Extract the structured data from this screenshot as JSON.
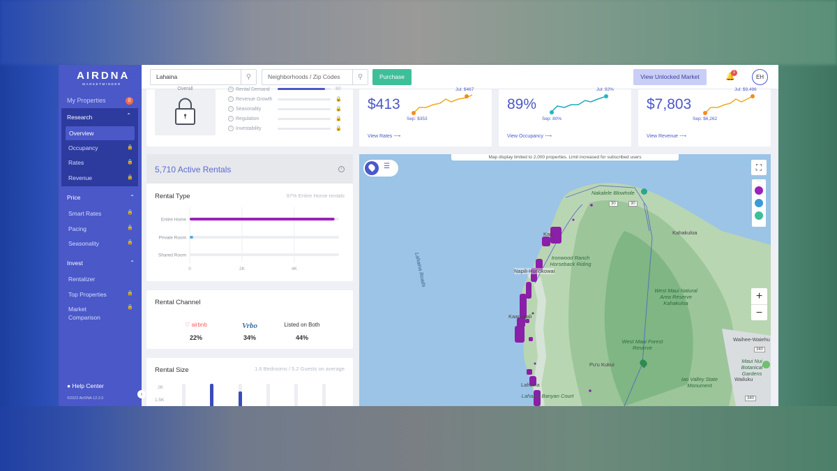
{
  "app": {
    "logo": "AIRDNA",
    "logo_sub": "MARKETMINDER",
    "copyright": "©2022 AirDNA 12.2.0"
  },
  "sidebar": {
    "my_properties": "My Properties",
    "my_properties_count": "0",
    "research": {
      "label": "Research",
      "items": [
        {
          "label": "Overview",
          "active": true
        },
        {
          "label": "Occupancy",
          "locked": true
        },
        {
          "label": "Rates",
          "locked": true
        },
        {
          "label": "Revenue",
          "locked": true
        }
      ]
    },
    "price": {
      "label": "Price",
      "items": [
        {
          "label": "Smart Rates",
          "locked": true
        },
        {
          "label": "Pacing",
          "locked": true
        },
        {
          "label": "Seasonality",
          "locked": true
        }
      ]
    },
    "invest": {
      "label": "Invest",
      "items": [
        {
          "label": "Rentalizer"
        },
        {
          "label": "Top Properties",
          "locked": true
        },
        {
          "label": "Market Comparison",
          "locked": true
        }
      ]
    },
    "help": "Help Center"
  },
  "topbar": {
    "market_value": "Lahaina",
    "neighborhood_placeholder": "Neighborhoods / Zip Codes",
    "purchase": "Purchase",
    "view_unlocked": "View Unlocked Market",
    "notifications": "1",
    "avatar": "EH"
  },
  "score": {
    "overall_label": "Overall",
    "factors": [
      {
        "label": "Rental Demand",
        "value": "80"
      },
      {
        "label": "Revenue Growth"
      },
      {
        "label": "Seasonality"
      },
      {
        "label": "Regulation"
      },
      {
        "label": "Investability"
      }
    ]
  },
  "kpis": [
    {
      "value": "$413",
      "low_label": "Sep: $353",
      "high_label": "Jul: $467",
      "link": "View Rates ⟶"
    },
    {
      "value": "89%",
      "low_label": "Sep: 80%",
      "high_label": "Jul: 92%",
      "link": "View Occupancy ⟶"
    },
    {
      "value": "$7,803",
      "low_label": "Sep: $6,262",
      "high_label": "Jul: $9,496",
      "link": "View Revenue ⟶"
    }
  ],
  "active_rentals": {
    "title": "5,710 Active Rentals"
  },
  "rental_type": {
    "title": "Rental Type",
    "subtitle": "97% Entire Home rentals",
    "chart_data": {
      "type": "bar",
      "orientation": "horizontal",
      "categories": [
        "Entire Home",
        "Private Room",
        "Shared Room"
      ],
      "values": [
        5540,
        130,
        0
      ],
      "xlim": [
        0,
        5710
      ],
      "ticks": [
        "0",
        "2K",
        "4K"
      ],
      "colors": [
        "#9b22b8",
        "#55a9e3",
        "#dddddd"
      ]
    }
  },
  "rental_channel": {
    "title": "Rental Channel",
    "channels": [
      {
        "name": "airbnb",
        "pct": "22%"
      },
      {
        "name": "Vrbo",
        "pct": "34%"
      },
      {
        "name": "Listed on Both",
        "pct": "44%"
      }
    ]
  },
  "rental_size": {
    "title": "Rental Size",
    "subtitle": "1.6 Bedrooms / 5.2 Guests on average",
    "ticks": [
      "2K",
      "1.5K"
    ]
  },
  "map": {
    "note": "Map display limited to 2,000 properties. Limit increased for subscribed users",
    "labels": {
      "nakalele": "Nakalele Blowhole",
      "kahakuloa": "Kahakuloa",
      "kapalua": "Kap",
      "napili": "Napili-Honokowai",
      "ironwood": "Ironwood Ranch Horseback Riding",
      "kaanapali": "Kaanapali",
      "westmaui1": "West Maui Natural Area Reserve Kahakuloa",
      "westmaui2": "West Maui Forest Reserve",
      "puukukui": "Pu'u Kukui",
      "waihee": "Waihee-Waiehu",
      "mauinui": "Maui Nui Botanical Gardens",
      "wailuku": "Wailuku",
      "iao": "Iao Valley State Monument",
      "lahaina": "Lahaina",
      "lahaina_court": "Lahaina Banyan Court",
      "roads": "Lahaina Roads",
      "r30a": "30",
      "r30b": "30",
      "r340a": "340",
      "r340b": "340"
    },
    "colors": {
      "listing": "#8a1fa8",
      "land": "#b8d8b0",
      "water": "#9bc4e6"
    }
  }
}
